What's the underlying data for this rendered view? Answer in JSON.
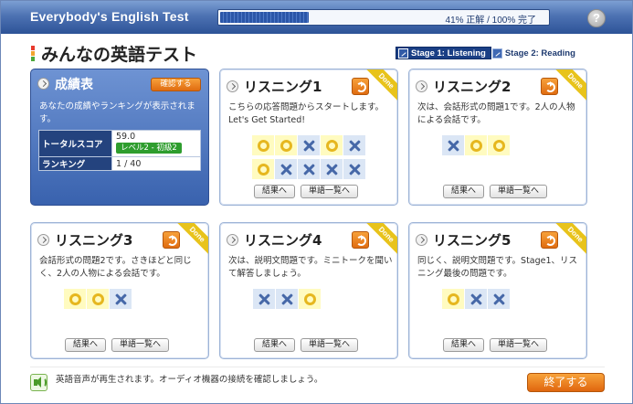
{
  "header": {
    "app_title": "Everybody's English Test",
    "progress_text": "41% 正解 / 100% 完了",
    "progress_fraction": 0.27,
    "help_glyph": "?"
  },
  "page_title": "みんなの英語テスト",
  "stages": [
    {
      "label": "Stage 1: Listening",
      "active": true
    },
    {
      "label": "Stage 2: Reading",
      "active": false
    }
  ],
  "score": {
    "title": "成績表",
    "confirm_label": "確認する",
    "description": "あなたの成績やランキングが表示されます。",
    "total_label": "トータルスコア",
    "total_value": "59.0",
    "level": "レベル2 - 初級2",
    "rank_label": "ランキング",
    "rank_value": "1 / 40"
  },
  "cards": [
    {
      "title": "リスニング1",
      "desc": "こちらの応答問題からスタートします。Let's Get Started!",
      "done": "Done",
      "marks": [
        [
          "o",
          "o",
          "x",
          "o",
          "x"
        ],
        [
          "o",
          "x",
          "x",
          "x",
          "x"
        ]
      ],
      "result_label": "結果へ",
      "words_label": "単語一覧へ"
    },
    {
      "title": "リスニング2",
      "desc": "次は、会話形式の問題1です。2人の人物による会話です。",
      "done": "Done",
      "marks": [
        [
          "x",
          "o",
          "o"
        ]
      ],
      "result_label": "結果へ",
      "words_label": "単語一覧へ"
    },
    {
      "title": "リスニング3",
      "desc": "会話形式の問題2です。さきほどと同じく、2人の人物による会話です。",
      "done": "Done",
      "marks": [
        [
          "o",
          "o",
          "x"
        ]
      ],
      "result_label": "結果へ",
      "words_label": "単語一覧へ"
    },
    {
      "title": "リスニング4",
      "desc": "次は、説明文問題です。ミニトークを聞いて解答しましょう。",
      "done": "Done",
      "marks": [
        [
          "x",
          "x",
          "o"
        ]
      ],
      "result_label": "結果へ",
      "words_label": "単語一覧へ"
    },
    {
      "title": "リスニング5",
      "desc": "同じく、説明文問題です。Stage1、リスニング最後の問題です。",
      "done": "Done",
      "marks": [
        [
          "o",
          "x",
          "x"
        ]
      ],
      "result_label": "結果へ",
      "words_label": "単語一覧へ"
    }
  ],
  "footer": {
    "note": "英語音声が再生されます。オーディオ機器の接続を確認しましょう。",
    "finish_label": "終了する"
  },
  "icons": {
    "help": "help-icon",
    "chevron": "chevron-right-icon",
    "go": "refresh-arrow-icon",
    "sound": "speaker-icon",
    "correct": "circle-mark-icon",
    "wrong": "cross-mark-icon"
  },
  "colors": {
    "header": "#2d5397",
    "accent_orange": "#e06c10",
    "correct": "#e6b71f",
    "wrong": "#4668a8",
    "done_ribbon": "#e8c31b"
  }
}
